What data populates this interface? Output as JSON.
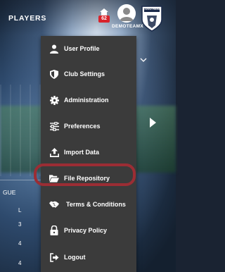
{
  "header": {
    "title": "PLAYERS",
    "notification_count": "62",
    "user_name": "DEMOTEAMX",
    "club_logo_text": "LOGO HERE"
  },
  "background": {
    "league_label": "GUE",
    "col_header": "L",
    "rows": [
      "3",
      "4",
      "4"
    ]
  },
  "menu": {
    "items": [
      {
        "label": "User Profile",
        "icon": "user-icon"
      },
      {
        "label": "Club Settings",
        "icon": "shield-icon"
      },
      {
        "label": "Administration",
        "icon": "gear-icon"
      },
      {
        "label": "Preferences",
        "icon": "sliders-icon"
      },
      {
        "label": "Import Data",
        "icon": "upload-icon"
      },
      {
        "label": "File Repository",
        "icon": "folder-open-icon"
      },
      {
        "label": "Terms & Conditions",
        "icon": "handshake-icon"
      },
      {
        "label": "Privacy Policy",
        "icon": "lock-icon"
      },
      {
        "label": "Logout",
        "icon": "logout-icon"
      }
    ],
    "highlighted_item": "File Repository"
  },
  "colors": {
    "menu_bg": "#3b3b3b",
    "highlight_border": "#9b2d34",
    "badge": "#d9232b"
  }
}
